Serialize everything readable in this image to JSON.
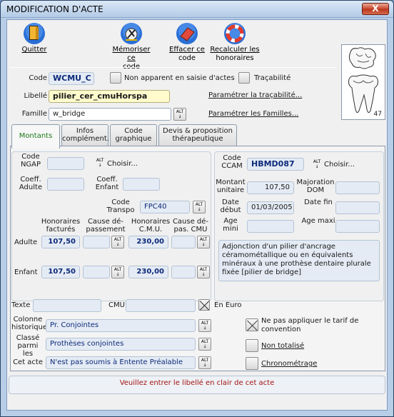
{
  "window": {
    "title": "MODIFICATION D'ACTE",
    "close_label": "X"
  },
  "toolbar": {
    "quit": "Quitter",
    "save": [
      "Mémoriser ce",
      "code"
    ],
    "erase": [
      "Effacer ce",
      "code"
    ],
    "recalc": [
      "Recalculer les",
      "honoraires"
    ]
  },
  "header": {
    "code_label": "Code",
    "code_value": "WCMU_C",
    "non_apparent_label": "Non apparent en saisie d'actes",
    "tracabilite_label": "Traçabilité",
    "libelle_label": "Libellé",
    "libelle_value": "pilier_cer_cmuHorspa",
    "param_trac": "Paramétrer la traçabilité...",
    "famille_label": "Famille",
    "famille_value": "w_bridge",
    "param_fam": "Paramétrer les Familles...",
    "tooth_number": "47"
  },
  "tabs": [
    "Montants",
    "Infos complément.",
    "Code graphique",
    "Devis & proposition thérapeutique"
  ],
  "alt": "ALT",
  "ngap": {
    "code_label": "Code NGAP",
    "choisir": "Choisir...",
    "coeff_adulte": "Coeff. Adulte",
    "coeff_enfant": "Coeff. Enfant",
    "code_transpo_label": "Code Transpo",
    "code_transpo_value": "FPC40"
  },
  "honoraires": {
    "col1": "Honoraires facturés",
    "col2": "Cause dé-passement",
    "col3": "Honoraires C.M.U.",
    "col4": "Cause dé-pas. CMU",
    "adulte_label": "Adulte",
    "enfant_label": "Enfant",
    "adulte_fact": "107,50",
    "adulte_cmu": "230,00",
    "enfant_fact": "107,50",
    "enfant_cmu": "230,00"
  },
  "ccam": {
    "code_label": "Code CCAM",
    "code_value": "HBMD087",
    "choisir": "Choisir...",
    "montant_label": "Montant unitaire",
    "montant_value": "107,50",
    "majoration_label": "Majoration DOM",
    "date_debut_label": "Date début",
    "date_debut_value": "01/03/2005",
    "date_fin_label": "Date fin",
    "age_mini_label": "Age mini",
    "age_maxi_label": "Age maxi",
    "description": "Adjonction d'un pilier d'ancrage céramométallique ou en équivalents minéraux à une prothèse dentaire plurale fixée [pilier de bridge]"
  },
  "misc": {
    "texte_label": "Texte",
    "cmu_label": "CMU",
    "en_euro_label": "En Euro",
    "colonne_label": "Colonne historique",
    "colonne_value": "Pr. Conjointes",
    "classe_label": "Classé parmi les",
    "classe_value": "Prothèses conjointes",
    "cet_acte_label": "Cet acte",
    "cet_acte_value": "N'est pas soumis à Entente Préalable",
    "ne_pas_appliquer": "Ne pas appliquer le tarif de convention",
    "non_totalise": "Non totalisé",
    "chronometrage": "Chronométrage"
  },
  "status": "Veuillez entrer le libellé en clair de cet acte",
  "colors": {
    "title_text": "#000000",
    "active_tab": "#1c7a1c",
    "status_text": "#a11414",
    "code_text": "#0d2a7a"
  }
}
